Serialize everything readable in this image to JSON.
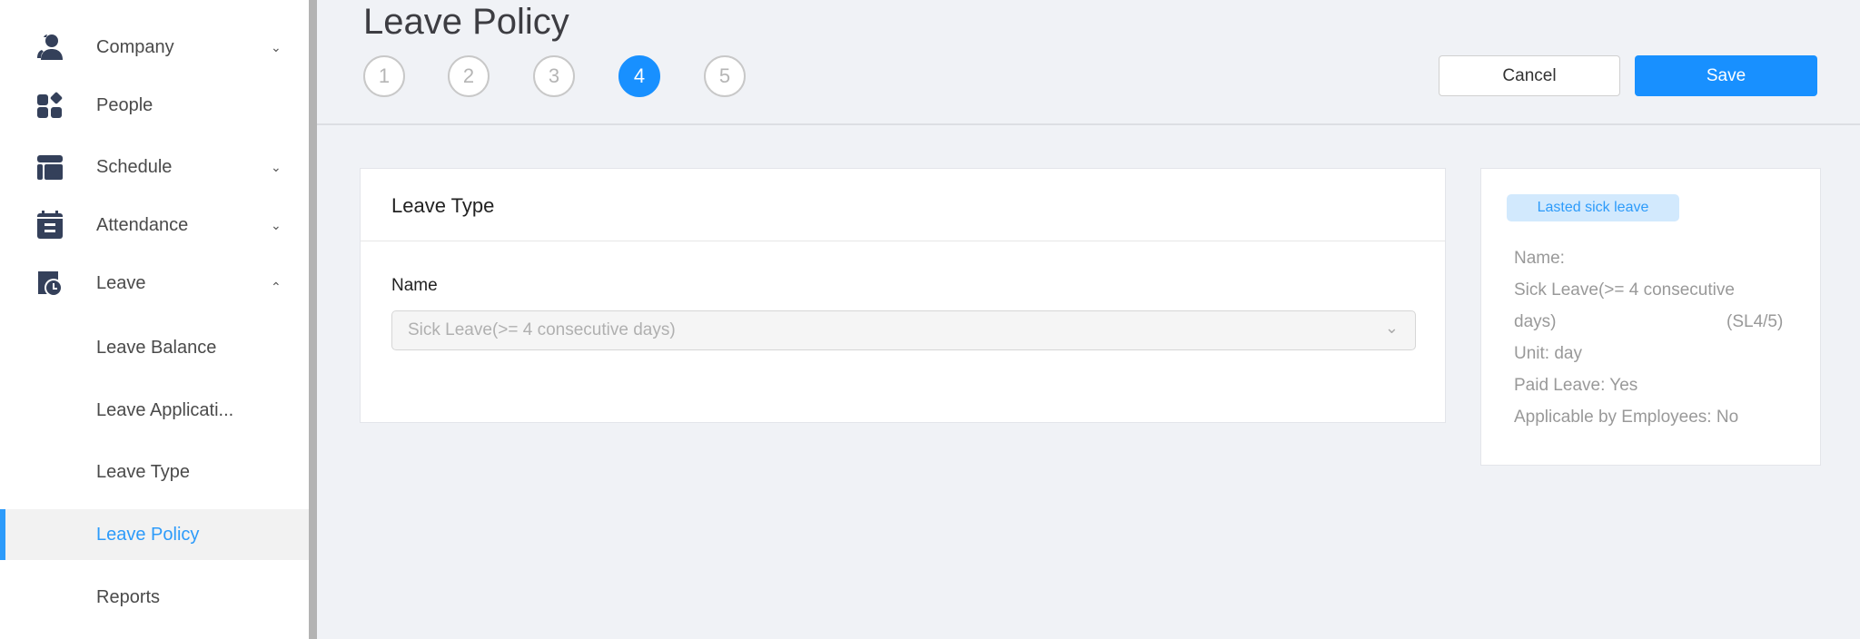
{
  "sidebar": {
    "items": [
      {
        "label": "Company",
        "icon": "users-icon",
        "chevron": "down"
      },
      {
        "label": "People",
        "icon": "apps-icon"
      },
      {
        "label": "Schedule",
        "icon": "layout-icon",
        "chevron": "down"
      },
      {
        "label": "Attendance",
        "icon": "calendar-icon",
        "chevron": "down"
      },
      {
        "label": "Leave",
        "icon": "leave-clock-icon",
        "chevron": "up"
      },
      {
        "label": "Leave Balance"
      },
      {
        "label": "Leave Applicati..."
      },
      {
        "label": "Leave Type"
      },
      {
        "label": "Leave Policy",
        "active": true
      },
      {
        "label": "Reports"
      }
    ]
  },
  "header": {
    "title": "Leave Policy",
    "steps": [
      "1",
      "2",
      "3",
      "4",
      "5"
    ],
    "current_step": 4,
    "cancel_label": "Cancel",
    "save_label": "Save"
  },
  "card": {
    "title": "Leave Type",
    "name_label": "Name",
    "name_value": "Sick Leave(>= 4 consecutive days)"
  },
  "panel": {
    "tag": "Lasted sick leave",
    "name_label": "Name:",
    "name_line1": "Sick Leave(>= 4 consecutive",
    "name_line2": "days)",
    "code": "(SL4/5)",
    "unit": "Unit: day",
    "paid": "Paid Leave: Yes",
    "applicable": "Applicable by Employees: No"
  },
  "colors": {
    "accent": "#1890ff",
    "icon": "#34405a",
    "tag_bg": "#d2e9fd"
  }
}
